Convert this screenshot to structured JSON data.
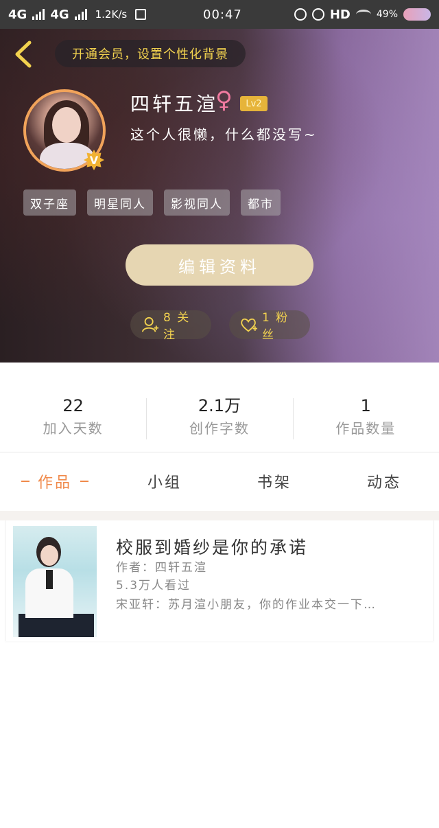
{
  "status_bar": {
    "network1": "4G",
    "network2": "4G",
    "speed": "1.2K/s",
    "time": "00:47",
    "hd": "HD",
    "battery": "49%"
  },
  "header": {
    "vip_banner": "开通会员，设置个性化背景",
    "username": "四轩五渲",
    "gender_symbol": "♀",
    "level": "Lv2",
    "bio": "这个人很懒，什么都没写~",
    "verified_badge": "V",
    "tags": [
      "双子座",
      "明星同人",
      "影视同人",
      "都市"
    ],
    "edit_button": "编辑资料",
    "following": "8 关注",
    "fans": "1 粉丝"
  },
  "stats": [
    {
      "value": "22",
      "label": "加入天数"
    },
    {
      "value": "2.1万",
      "label": "创作字数"
    },
    {
      "value": "1",
      "label": "作品数量"
    }
  ],
  "tabs": [
    {
      "label": "作品",
      "active": true
    },
    {
      "label": "小组",
      "active": false
    },
    {
      "label": "书架",
      "active": false
    },
    {
      "label": "动态",
      "active": false
    }
  ],
  "works": [
    {
      "title": "校服到婚纱是你的承诺",
      "author": "作者：四轩五渲",
      "views": "5.3万人看过",
      "excerpt": "宋亚轩：苏月渲小朋友，你的作业本交一下…"
    }
  ],
  "colors": {
    "accent_orange": "#f08a4b",
    "gold": "#f2d24f",
    "edit_button_bg": "#e6d6b2"
  },
  "icons": {
    "back": "chevron-left-icon",
    "follow": "add-user-icon",
    "fans": "heart-plus-icon"
  }
}
